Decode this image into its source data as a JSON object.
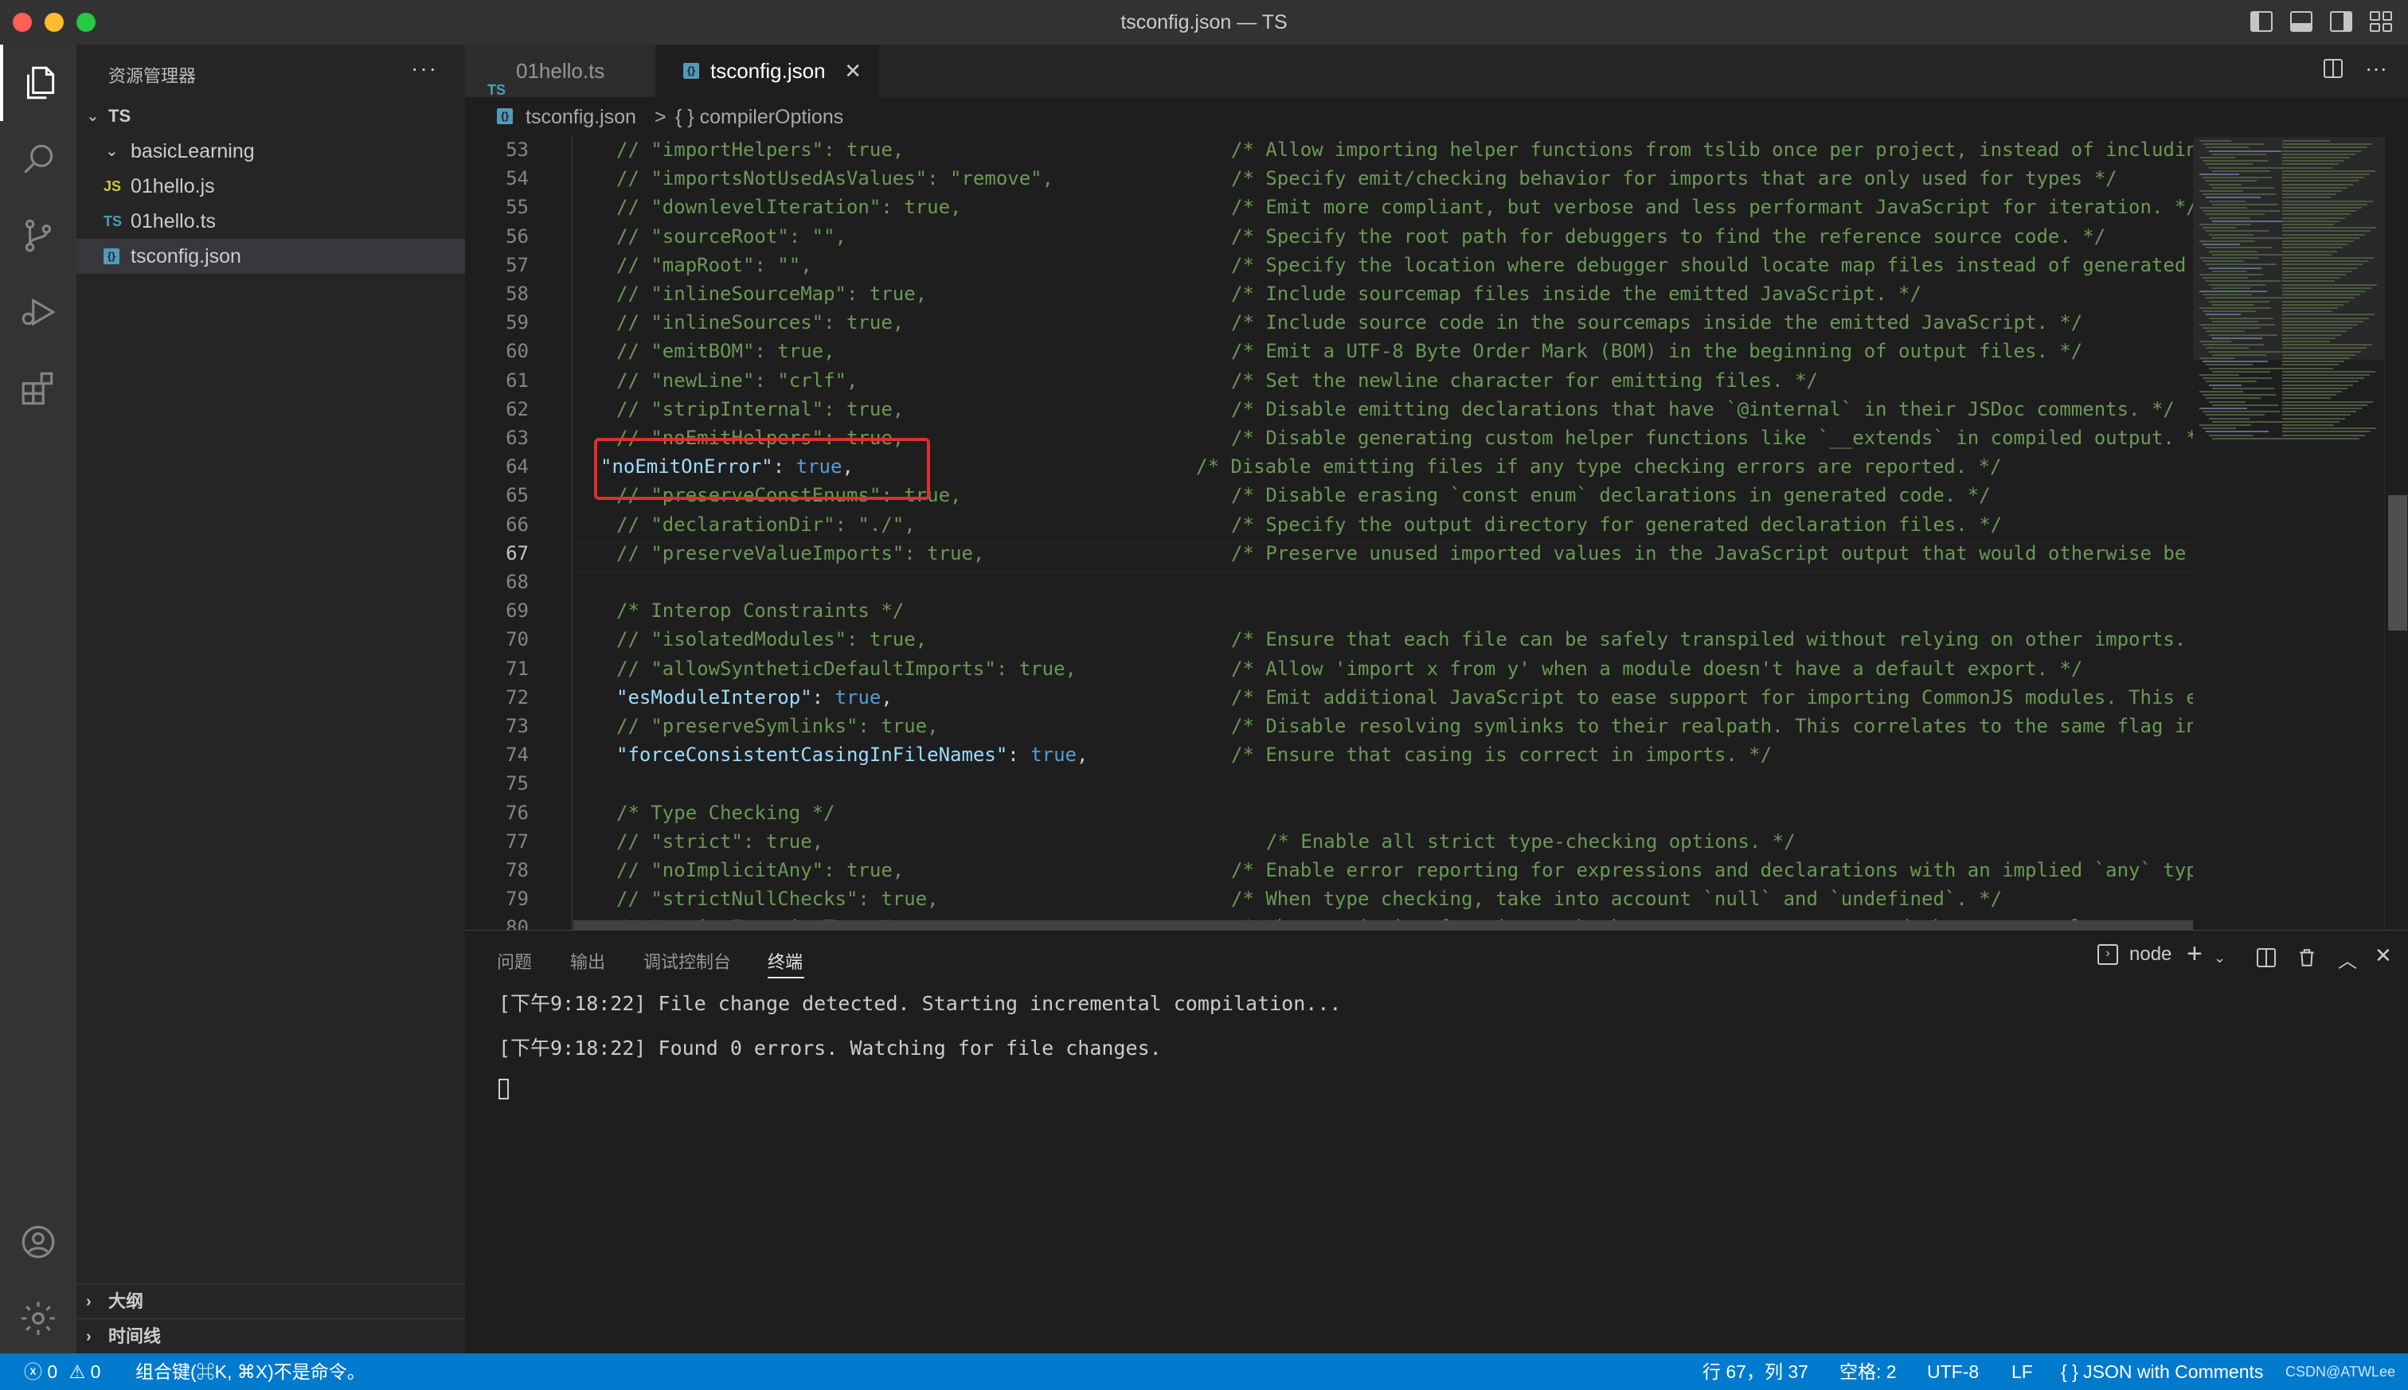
{
  "window": {
    "title": "tsconfig.json — TS"
  },
  "sidebar": {
    "title": "资源管理器",
    "more": "···",
    "root": "TS",
    "items": [
      {
        "label": "basicLearning",
        "type": "folder"
      },
      {
        "label": "01hello.js",
        "icon": "JS"
      },
      {
        "label": "01hello.ts",
        "icon": "TS"
      },
      {
        "label": "tsconfig.json",
        "icon": "{}"
      }
    ],
    "sections": [
      "大纲",
      "时间线"
    ]
  },
  "tabs": [
    {
      "label": "01hello.ts",
      "icon": "TS"
    },
    {
      "label": "tsconfig.json",
      "icon": "{}"
    }
  ],
  "breadcrumb": {
    "file": "tsconfig.json",
    "separator": ">",
    "symbol": "{ } compilerOptions"
  },
  "editor": {
    "current_line": 67,
    "lines": [
      {
        "n": "53",
        "code": "// \"importHelpers\": true,",
        "comment": "/* Allow importing helper functions from tslib once per project, instead of includin"
      },
      {
        "n": "54",
        "code": "// \"importsNotUsedAsValues\": \"remove\",",
        "comment": "/* Specify emit/checking behavior for imports that are only used for types */"
      },
      {
        "n": "55",
        "code": "// \"downlevelIteration\": true,",
        "comment": "/* Emit more compliant, but verbose and less performant JavaScript for iteration. */"
      },
      {
        "n": "56",
        "code": "// \"sourceRoot\": \"\",",
        "comment": "/* Specify the root path for debuggers to find the reference source code. */"
      },
      {
        "n": "57",
        "code": "// \"mapRoot\": \"\",",
        "comment": "/* Specify the location where debugger should locate map files instead of generated"
      },
      {
        "n": "58",
        "code": "// \"inlineSourceMap\": true,",
        "comment": "/* Include sourcemap files inside the emitted JavaScript. */"
      },
      {
        "n": "59",
        "code": "// \"inlineSources\": true,",
        "comment": "/* Include source code in the sourcemaps inside the emitted JavaScript. */"
      },
      {
        "n": "60",
        "code": "// \"emitBOM\": true,",
        "comment": "/* Emit a UTF-8 Byte Order Mark (BOM) in the beginning of output files. */"
      },
      {
        "n": "61",
        "code": "// \"newLine\": \"crlf\",",
        "comment": "/* Set the newline character for emitting files. */"
      },
      {
        "n": "62",
        "code": "// \"stripInternal\": true,",
        "comment": "/* Disable emitting declarations that have `@internal` in their JSDoc comments. */"
      },
      {
        "n": "63",
        "code": "// \"noEmitHelpers\": true,",
        "comment": "/* Disable generating custom helper functions like `__extends` in compiled output. *"
      },
      {
        "n": "64",
        "key": "\"noEmitOnError\"",
        "sep": ": ",
        "val": "true",
        "end": ",",
        "comment": "/* Disable emitting files if any type checking errors are reported. */"
      },
      {
        "n": "65",
        "code": "// \"preserveConstEnums\": true,",
        "comment": "/* Disable erasing `const enum` declarations in generated code. */"
      },
      {
        "n": "66",
        "code": "// \"declarationDir\": \"./\",",
        "comment": "/* Specify the output directory for generated declaration files. */"
      },
      {
        "n": "67",
        "code": "// \"preserveValueImports\": true,",
        "comment": "/* Preserve unused imported values in the JavaScript output that would otherwise be"
      },
      {
        "n": "68",
        "code": "",
        "comment": ""
      },
      {
        "n": "69",
        "code": "/* Interop Constraints */",
        "comment": ""
      },
      {
        "n": "70",
        "code": "// \"isolatedModules\": true,",
        "comment": "/* Ensure that each file can be safely transpiled without relying on other imports. "
      },
      {
        "n": "71",
        "code": "// \"allowSyntheticDefaultImports\": true,",
        "comment": "/* Allow 'import x from y' when a module doesn't have a default export. */"
      },
      {
        "n": "72",
        "key": "\"esModuleInterop\"",
        "sep": ": ",
        "val": "true",
        "end": ",",
        "comment": "/* Emit additional JavaScript to ease support for importing CommonJS modules. This e"
      },
      {
        "n": "73",
        "code": "// \"preserveSymlinks\": true,",
        "comment": "/* Disable resolving symlinks to their realpath. This correlates to the same flag in"
      },
      {
        "n": "74",
        "key": "\"forceConsistentCasingInFileNames\"",
        "sep": ": ",
        "val": "true",
        "end": ",",
        "comment": "/* Ensure that casing is correct in imports. */"
      },
      {
        "n": "75",
        "code": "",
        "comment": ""
      },
      {
        "n": "76",
        "code": "/* Type Checking */",
        "comment": ""
      },
      {
        "n": "77",
        "code": "// \"strict\": true,",
        "comment": "/* Enable all strict type-checking options. */"
      },
      {
        "n": "78",
        "code": "// \"noImplicitAny\": true,",
        "comment": "/* Enable error reporting for expressions and declarations with an implied `any` typ"
      },
      {
        "n": "79",
        "code": "// \"strictNullChecks\": true,",
        "comment": "/* When type checking, take into account `null` and `undefined`. */"
      },
      {
        "n": "80",
        "code": "// \"strictFunctionTypes\": true,",
        "comment": "/* When assigning functions, check to ensure parameters and the return values are su"
      }
    ]
  },
  "panel": {
    "tabs": [
      "问题",
      "输出",
      "调试控制台",
      "终端"
    ],
    "active_tab": "终端",
    "shell": "node",
    "terminal_lines": [
      "[下午9:18:22] File change detected. Starting incremental compilation...",
      "[下午9:18:22] Found 0 errors. Watching for file changes."
    ]
  },
  "statusbar": {
    "errors": "0",
    "warnings": "0",
    "message": "组合键(⌘K, ⌘X)不是命令。",
    "position": "行 67，列 37",
    "spaces": "空格: 2",
    "encoding": "UTF-8",
    "eol": "LF",
    "language": "JSON with Comments",
    "watermark": "CSDN@ATWLee"
  },
  "colors": {
    "accent": "#007acc",
    "highlight_box": "#e0302a",
    "comment": "#6a9955",
    "key": "#9cdcfe",
    "keyword": "#569cd6"
  }
}
